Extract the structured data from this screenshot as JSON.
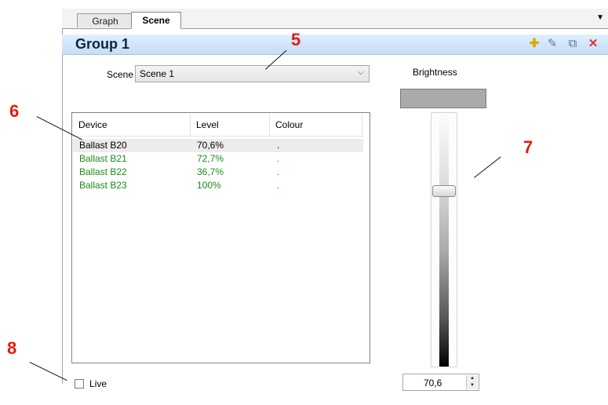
{
  "tabs": [
    {
      "label": "Graph",
      "active": false
    },
    {
      "label": "Scene",
      "active": true
    }
  ],
  "group": {
    "title": "Group 1"
  },
  "toolbar_icons": [
    "add-icon",
    "edit-icon",
    "copy-icon",
    "delete-icon"
  ],
  "scene": {
    "label": "Scene",
    "value": "Scene 1"
  },
  "list": {
    "columns": [
      "Device",
      "Level",
      "Colour"
    ],
    "rows": [
      {
        "device": "Ballast B20",
        "level": "70,6%",
        "colour": ".",
        "selected": true
      },
      {
        "device": "Ballast B21",
        "level": "72,7%",
        "colour": ".",
        "selected": false
      },
      {
        "device": "Ballast B22",
        "level": "36,7%",
        "colour": ".",
        "selected": false
      },
      {
        "device": "Ballast B23",
        "level": "100%",
        "colour": ".",
        "selected": false
      }
    ]
  },
  "live": {
    "label": "Live",
    "checked": false
  },
  "brightness": {
    "label": "Brightness",
    "value_text": "70,6",
    "level_fraction": 0.706
  },
  "colors": {
    "green_text": "#1a8c1a",
    "red_dot": "#e23030",
    "accent_callout": "#e8190f"
  },
  "annotations": [
    "5",
    "6",
    "7",
    "8"
  ]
}
